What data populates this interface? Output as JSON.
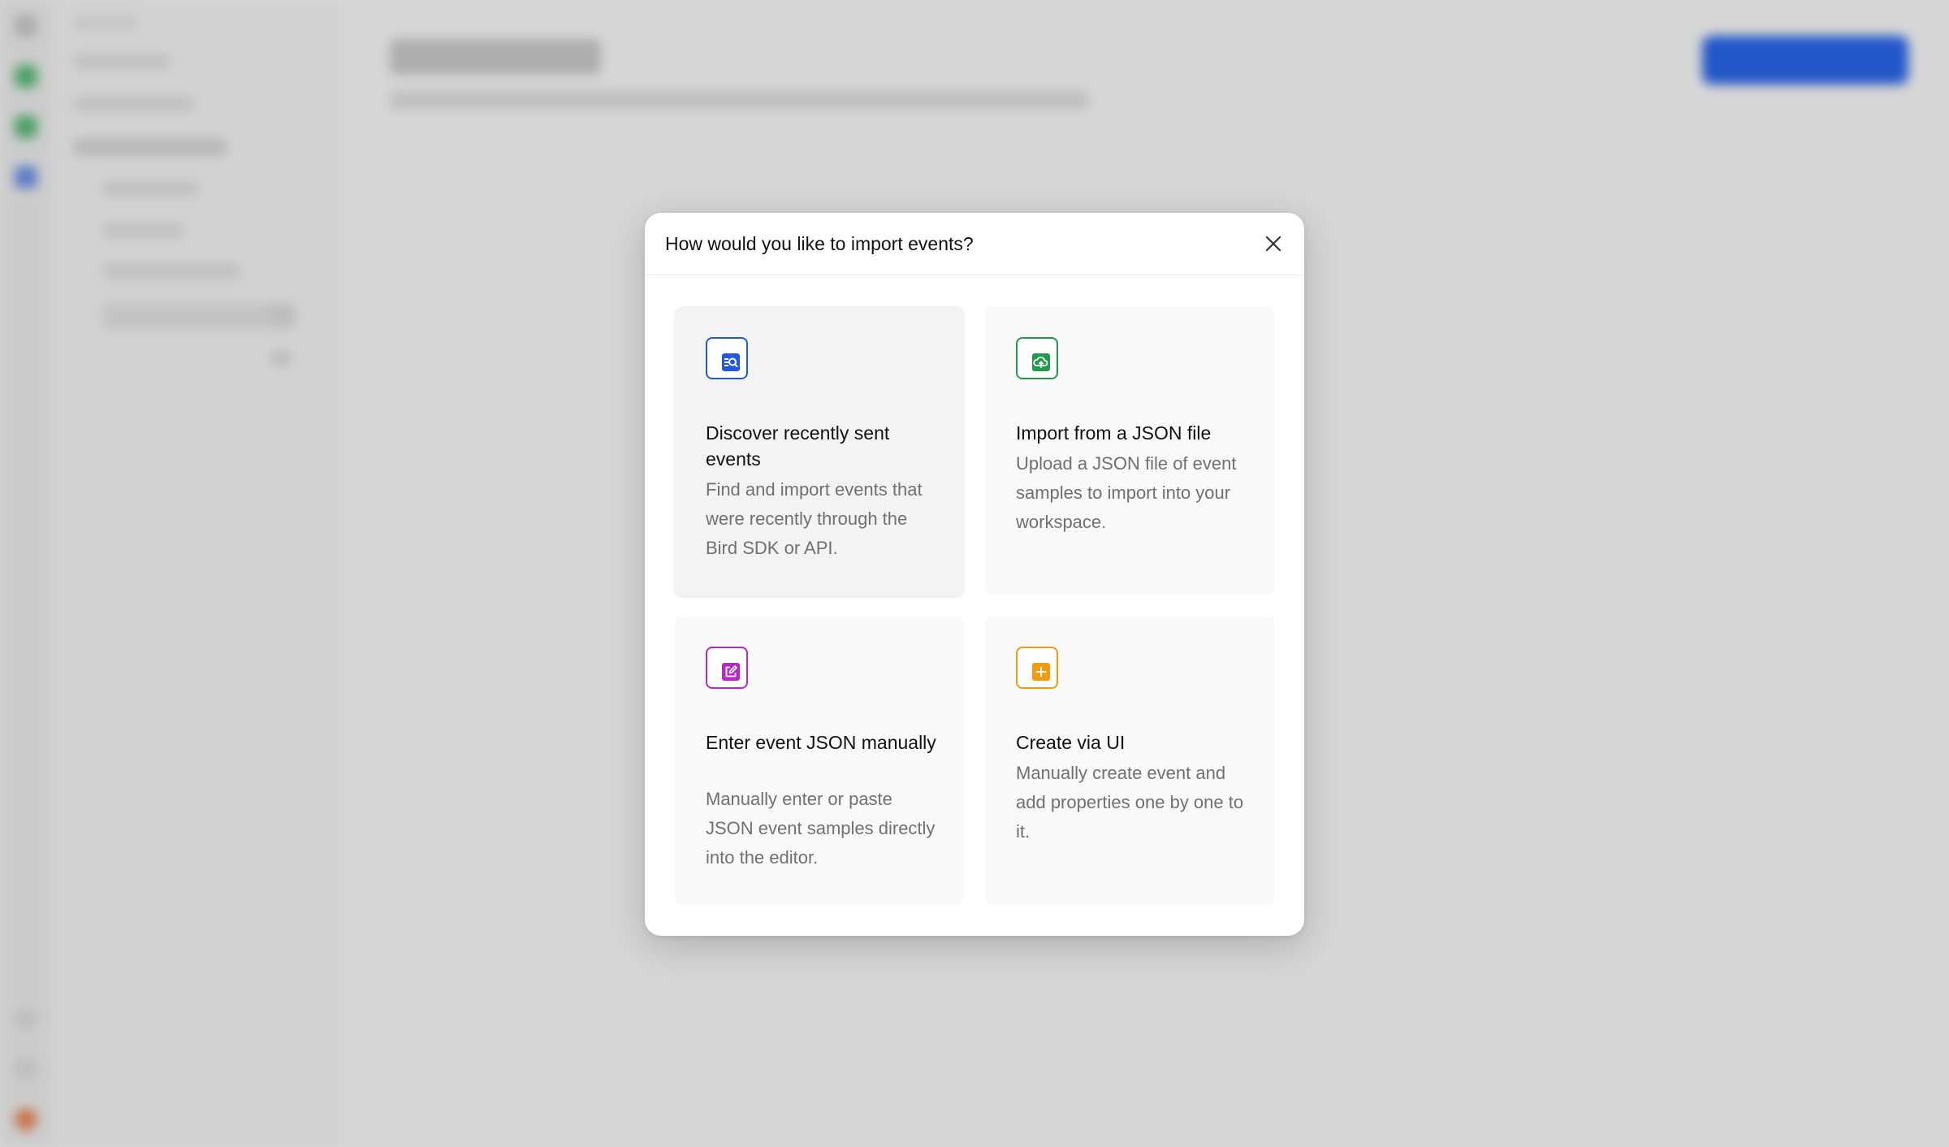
{
  "modal": {
    "title": "How would you like to import events?",
    "close_icon": "close-icon",
    "options": [
      {
        "title": "Discover recently sent events",
        "description": "Find and import events that were recently through the Bird SDK or API.",
        "icon": "discover-icon",
        "accent": "#2257e0"
      },
      {
        "title": "Import from a JSON file",
        "description": "Upload a JSON file of event samples to import into your workspace.",
        "icon": "cloud-upload-icon",
        "accent": "#1f9a4a"
      },
      {
        "title": "Enter event JSON manually",
        "description": "Manually enter or paste JSON event samples directly into the editor.",
        "icon": "edit-icon",
        "accent": "#b728c8"
      },
      {
        "title": "Create via UI",
        "description": "Manually create event and add properties one by one to it.",
        "icon": "plus-icon",
        "accent": "#f29a10"
      }
    ]
  },
  "colors": {
    "overlay": "rgba(0,0,0,0.16)",
    "primary": "#2a68f0",
    "text_primary": "#111111",
    "text_secondary": "#707070",
    "card_bg": "#f9f9f9"
  }
}
